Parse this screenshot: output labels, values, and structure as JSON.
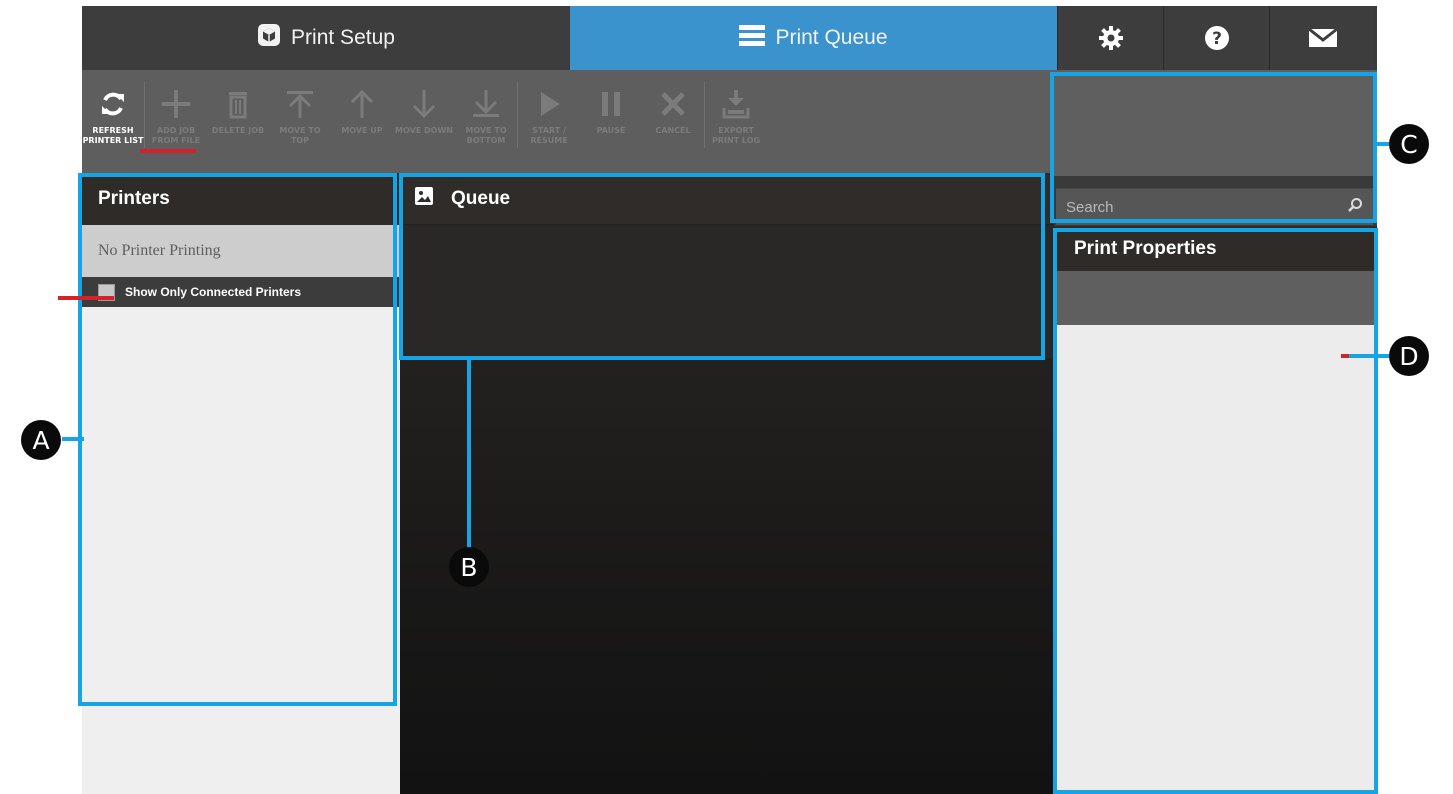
{
  "nav": {
    "tabs": [
      {
        "label": "Print Setup",
        "icon": "box-icon"
      },
      {
        "label": "Print Queue",
        "icon": "hamburger-icon"
      }
    ],
    "icon_buttons": [
      "gear-icon",
      "help-icon",
      "mail-icon"
    ]
  },
  "toolbar": {
    "buttons": [
      {
        "label": "REFRESH PRINTER LIST",
        "icon": "refresh-icon",
        "enabled": true
      },
      {
        "label": "ADD JOB FROM FILE",
        "icon": "plus-icon",
        "enabled": false
      },
      {
        "label": "DELETE JOB",
        "icon": "trash-icon",
        "enabled": false
      },
      {
        "label": "MOVE TO TOP",
        "icon": "move-to-top-icon",
        "enabled": false
      },
      {
        "label": "MOVE UP",
        "icon": "arrow-up-icon",
        "enabled": false
      },
      {
        "label": "MOVE DOWN",
        "icon": "arrow-down-icon",
        "enabled": false
      },
      {
        "label": "MOVE TO BOTTOM",
        "icon": "move-to-bottom-icon",
        "enabled": false
      },
      {
        "label": "START / RESUME",
        "icon": "play-icon",
        "enabled": false
      },
      {
        "label": "PAUSE",
        "icon": "pause-icon",
        "enabled": false
      },
      {
        "label": "CANCEL",
        "icon": "x-icon",
        "enabled": false
      },
      {
        "label": "EXPORT PRINT LOG",
        "icon": "export-icon",
        "enabled": false
      }
    ]
  },
  "search": {
    "placeholder": "Search",
    "icon": "search-icon"
  },
  "printers": {
    "title": "Printers",
    "status": "No Printer Printing",
    "filter_label": "Show Only Connected Printers"
  },
  "queue": {
    "title": "Queue",
    "icon": "image-icon"
  },
  "properties": {
    "title": "Print Properties"
  },
  "annotations": {
    "a": "A",
    "b": "B",
    "c": "C",
    "d": "D"
  },
  "colors": {
    "accent": "#3a93cc",
    "highlight": "#17a4e4",
    "marker": "#d4222a"
  }
}
